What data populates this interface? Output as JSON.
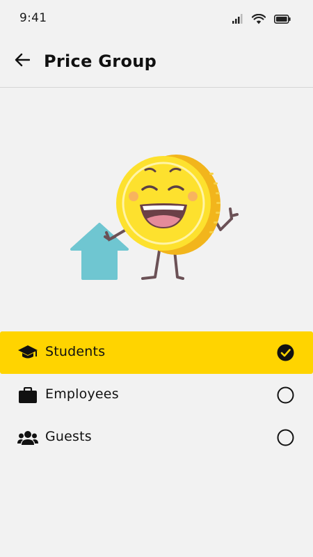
{
  "status_bar": {
    "time": "9:41",
    "icons": [
      "signal-icon",
      "wifi-icon",
      "battery-icon"
    ]
  },
  "header": {
    "back_icon": "arrow-left-icon",
    "title": "Price Group"
  },
  "illustration": {
    "name": "happy-coin-mascot",
    "colors": {
      "coin": "#fde12e",
      "coin_edge": "#f2b51c",
      "arrow": "#6fc6d1"
    }
  },
  "options": [
    {
      "label": "Students",
      "icon": "graduation-cap-icon",
      "selected": true
    },
    {
      "label": "Employees",
      "icon": "briefcase-icon",
      "selected": false
    },
    {
      "label": "Guests",
      "icon": "group-icon",
      "selected": false
    }
  ],
  "colors": {
    "accent": "#ffd400",
    "background": "#f2f2f2",
    "text": "#111111"
  }
}
